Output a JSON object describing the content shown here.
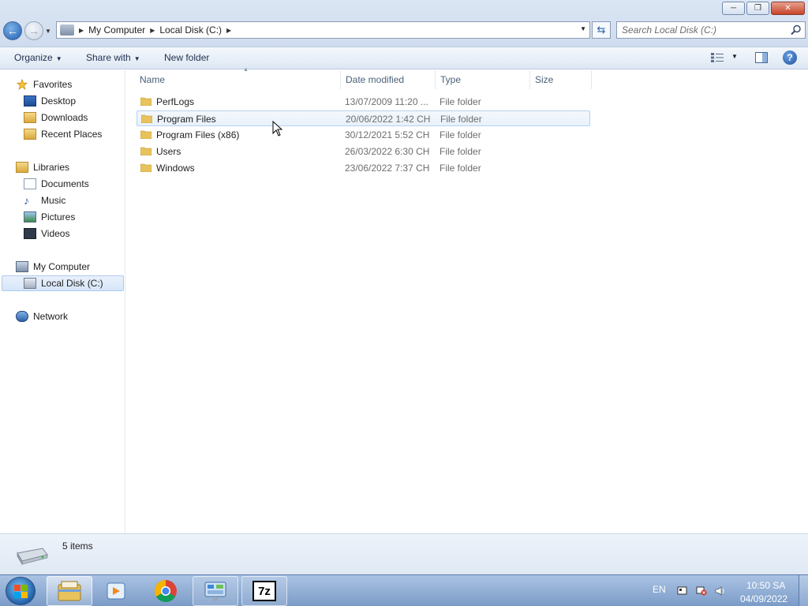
{
  "window": {
    "minimize": "─",
    "maximize": "❐",
    "close": "✕"
  },
  "address": {
    "crumbs": [
      "My Computer",
      "Local Disk (C:)"
    ],
    "search_placeholder": "Search Local Disk (C:)"
  },
  "toolbar": {
    "organize": "Organize",
    "share_with": "Share with",
    "new_folder": "New folder"
  },
  "nav": {
    "favorites": "Favorites",
    "desktop": "Desktop",
    "downloads": "Downloads",
    "recent_places": "Recent Places",
    "libraries": "Libraries",
    "documents": "Documents",
    "music": "Music",
    "pictures": "Pictures",
    "videos": "Videos",
    "my_computer": "My Computer",
    "local_disk": "Local Disk (C:)",
    "network": "Network"
  },
  "columns": {
    "name": "Name",
    "date_modified": "Date modified",
    "type": "Type",
    "size": "Size"
  },
  "files": [
    {
      "name": "PerfLogs",
      "date": "13/07/2009 11:20 ...",
      "type": "File folder",
      "size": ""
    },
    {
      "name": "Program Files",
      "date": "20/06/2022 1:42 CH",
      "type": "File folder",
      "size": ""
    },
    {
      "name": "Program Files (x86)",
      "date": "30/12/2021 5:52 CH",
      "type": "File folder",
      "size": ""
    },
    {
      "name": "Users",
      "date": "26/03/2022 6:30 CH",
      "type": "File folder",
      "size": ""
    },
    {
      "name": "Windows",
      "date": "23/06/2022 7:37 CH",
      "type": "File folder",
      "size": ""
    }
  ],
  "status": {
    "item_count": "5 items"
  },
  "taskbar": {
    "apps": [
      "explorer-icon",
      "media-player-icon",
      "chrome-icon",
      "control-panel-icon",
      "7zip-icon"
    ],
    "seven_zip_label": "7z",
    "language": "EN",
    "time": "10:50 SA",
    "date": "04/09/2022"
  }
}
